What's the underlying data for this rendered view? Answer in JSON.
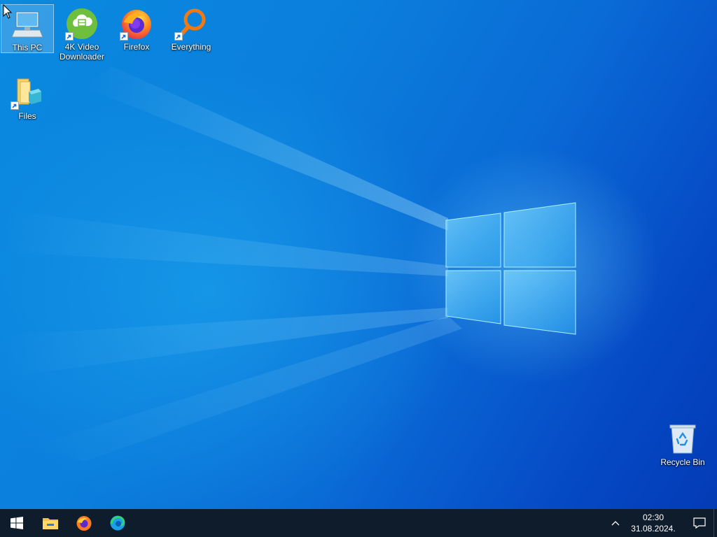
{
  "desktop": {
    "icons": [
      {
        "label": "This PC",
        "icon": "this-pc-icon"
      },
      {
        "label": "4K Video Downloader",
        "icon": "4k-video-downloader-icon"
      },
      {
        "label": "Firefox",
        "icon": "firefox-icon"
      },
      {
        "label": "Everything",
        "icon": "everything-search-icon"
      },
      {
        "label": "Files",
        "icon": "files-folder-icon"
      },
      {
        "label": "Recycle Bin",
        "icon": "recycle-bin-icon"
      }
    ]
  },
  "taskbar": {
    "pinned": [
      {
        "icon": "windows-start-icon"
      },
      {
        "icon": "file-explorer-icon"
      },
      {
        "icon": "firefox-icon"
      },
      {
        "icon": "edge-icon"
      }
    ],
    "tray": {
      "time": "02:30",
      "date": "31.08.2024."
    }
  },
  "colors": {
    "taskbar": "#0f1c2b",
    "wallpaper_light": "#0a8ae0",
    "wallpaper_dark": "#043bb5"
  }
}
